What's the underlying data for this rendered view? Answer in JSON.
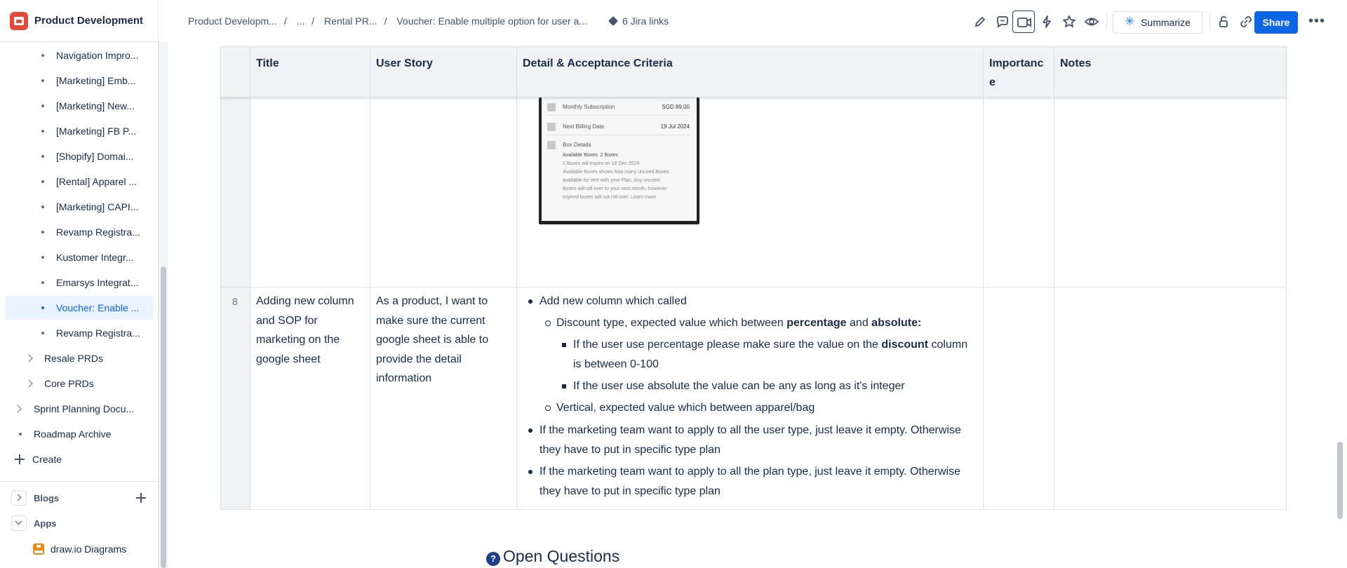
{
  "space": {
    "name": "Product Development"
  },
  "sidebar": {
    "items": [
      {
        "label": "Navigation Impro..."
      },
      {
        "label": "[Marketing] Emb..."
      },
      {
        "label": "[Marketing] New..."
      },
      {
        "label": "[Marketing] FB P..."
      },
      {
        "label": "[Shopify] Domai..."
      },
      {
        "label": "[Rental] Apparel ..."
      },
      {
        "label": "[Marketing] CAPI..."
      },
      {
        "label": "Revamp Registra..."
      },
      {
        "label": "Kustomer Integr..."
      },
      {
        "label": "Emarsys Integrat..."
      },
      {
        "label": "Voucher: Enable ..."
      },
      {
        "label": "Revamp Registra..."
      }
    ],
    "groups": [
      {
        "label": "Resale PRDs"
      },
      {
        "label": "Core PRDs"
      },
      {
        "label": "Sprint Planning Docu..."
      },
      {
        "label": "Roadmap Archive"
      }
    ],
    "create_label": "Create",
    "blogs_label": "Blogs",
    "apps_label": "Apps",
    "app_item_label": "draw.io Diagrams"
  },
  "breadcrumb": {
    "items": [
      "Product Developm...",
      "...",
      "Rental PR...",
      "Voucher: Enable multiple option for user a..."
    ],
    "separator": "/"
  },
  "jira": {
    "label": "6 Jira links"
  },
  "toolbar": {
    "summarize_label": "Summarize",
    "share_label": "Share",
    "more_label": "•••"
  },
  "table": {
    "headers": [
      "Title",
      "User Story",
      "Detail & Acceptance Criteria",
      "Importanc e",
      "Notes"
    ],
    "screenshot_rows": [
      {
        "label": "Monthly Subscription",
        "value": "SGD 89.00"
      },
      {
        "label": "Next Billing Date",
        "value": "19 Jul 2024"
      },
      {
        "label": "Box Details",
        "value": ""
      }
    ],
    "screenshot_lines": [
      "Available Boxes: 2 Boxes",
      "2 Boxes will expire on 18 Dec 2024",
      "Available Boxes shows how many unused Boxes",
      "available for rent with your Plan. Any unused",
      "Boxes will roll over to your next month, however",
      "expired boxes will not roll over. Learn more."
    ],
    "row8": {
      "number": "8",
      "title": "Adding new column and SOP for marketing on the google sheet",
      "story": "As a product, I want to make sure the current google sheet is able to provide the detail information",
      "b1": "Add new column which called",
      "b1_1_pre": "Discount type, expected value which between ",
      "b1_1_bold1": "percentage",
      "b1_1_mid": " and ",
      "b1_1_bold2": "absolute:",
      "b1_1_1_pre": "If the user use percentage please make sure the value on the ",
      "b1_1_1_bold": "discount",
      "b1_1_1_post": " column is between 0-100",
      "b1_1_2": "If the user use absolute the value can be any as long as it's integer",
      "b1_2": "Vertical, expected value which between apparel/bag",
      "b2": "If the marketing team want to apply to all the user type, just leave it empty. Otherwise they have to put in specific type plan",
      "b3": "If the marketing team want to apply to all the plan type, just leave it empty. Otherwise they have to put in specific type plan"
    }
  },
  "section": {
    "title": "Open Questions",
    "icon": "?"
  }
}
